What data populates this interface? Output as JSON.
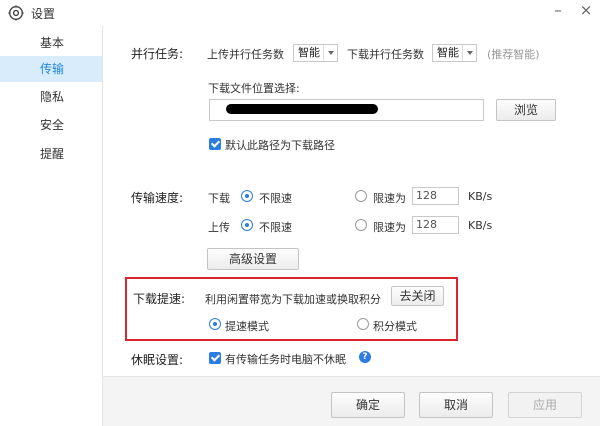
{
  "window": {
    "title": "设置",
    "minimize": "–",
    "close": "×"
  },
  "sidebar": {
    "items": [
      {
        "label": "基本"
      },
      {
        "label": "传输"
      },
      {
        "label": "隐私"
      },
      {
        "label": "安全"
      },
      {
        "label": "提醒"
      }
    ],
    "active_index": 1
  },
  "parallel": {
    "label": "并行任务:",
    "upload_label": "上传并行任务数",
    "upload_value": "智能",
    "download_label": "下载并行任务数",
    "download_value": "智能",
    "hint": "(推荐智能)"
  },
  "download_path": {
    "label": "下载文件位置选择:",
    "value": "",
    "browse": "浏览",
    "default_checkbox": "默认此路径为下载路径",
    "default_checked": true
  },
  "speed": {
    "label": "传输速度:",
    "download_label": "下载",
    "upload_label": "上传",
    "unlimited": "不限速",
    "limit_label": "限速为",
    "download_limit": "128",
    "upload_limit": "128",
    "unit": "KB/s",
    "download_mode": "unlimited",
    "upload_mode": "unlimited",
    "advanced": "高级设置"
  },
  "accel": {
    "label": "下载提速:",
    "description": "利用闲置带宽为下载加速或换取积分",
    "close_btn": "去关闭",
    "mode_speed": "提速模式",
    "mode_points": "积分模式",
    "selected": "speed"
  },
  "sleep": {
    "label": "休眠设置:",
    "checkbox": "有传输任务时电脑不休眠",
    "checked": true,
    "help": "?"
  },
  "footer": {
    "ok": "确定",
    "cancel": "取消",
    "apply": "应用"
  },
  "colors": {
    "accent": "#2b7de1",
    "highlight_border": "#d9262c",
    "active_nav_bg": "#d9ecfb"
  }
}
